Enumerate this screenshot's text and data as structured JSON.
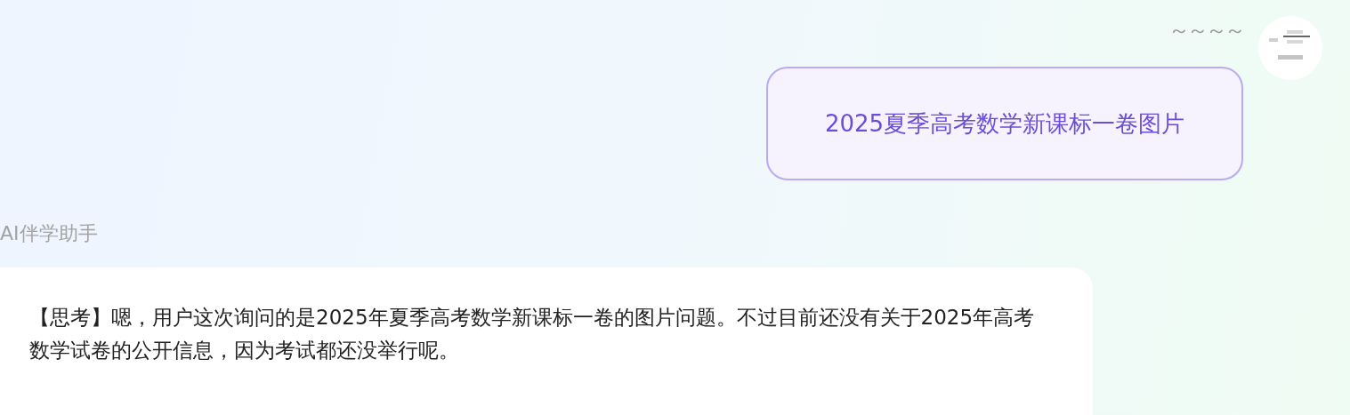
{
  "user_message": {
    "name": "～～～～",
    "text": "2025夏季高考数学新课标一卷图片"
  },
  "assistant_message": {
    "name": "AI伴学助手",
    "text": "【思考】嗯，用户这次询问的是2025年夏季高考数学新课标一卷的图片问题。不过目前还没有关于2025年高考数学试卷的公开信息，因为考试都还没举行呢。"
  }
}
